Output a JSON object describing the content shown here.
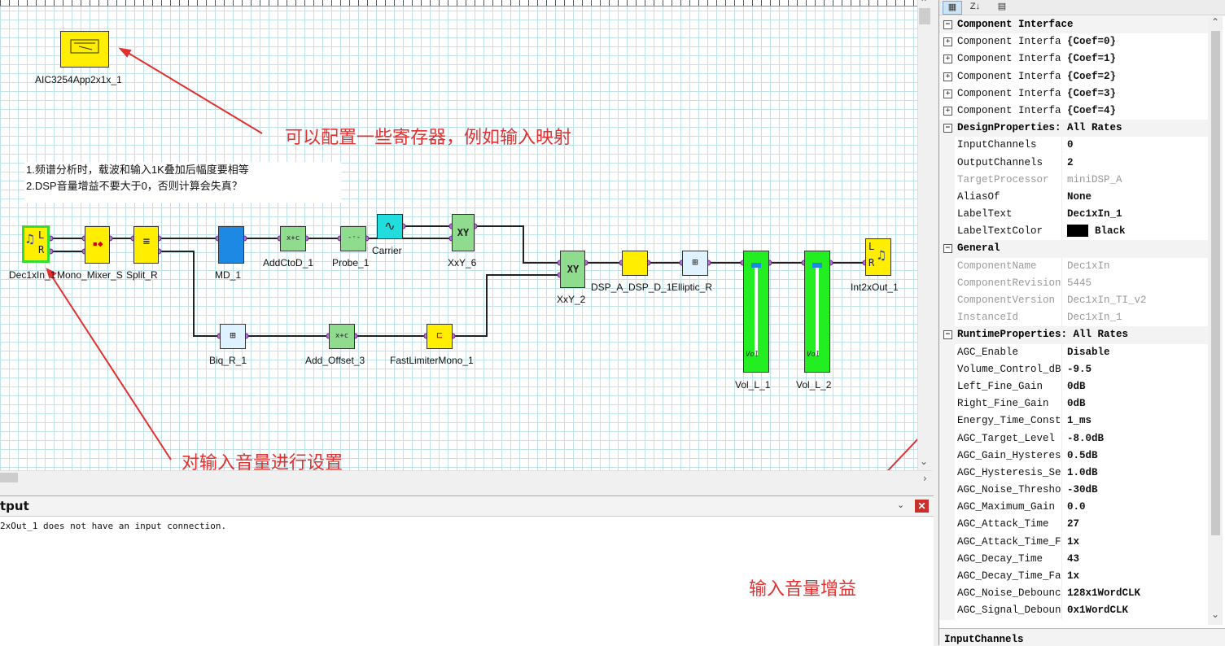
{
  "diagram": {
    "blocks": {
      "aic": "AIC3254App2x1x_1",
      "dec": "Dec1xIn_1",
      "mono": "Mono_Mixer_S",
      "split": "Split_R",
      "md": "MD_1",
      "addctod": "AddCtoD_1",
      "probe": "Probe_1",
      "carrier": "Carrier",
      "xxy6": "XxY_6",
      "xxy2": "XxY_2",
      "dspad": "DSP_A_DSP_D_1",
      "elliptic": "Elliptic_R",
      "voll1": "Vol_L_1",
      "voll2": "Vol_L_2",
      "int2x": "Int2xOut_1",
      "biq": "Biq_R_1",
      "addoffset": "Add_Offset_3",
      "limiter": "FastLimiterMono_1"
    },
    "glyphs": {
      "xy": "XY",
      "add": "x+c",
      "vol": "Vol"
    },
    "note_lines": [
      "1.频谱分析时，载波和输入1K叠加后幅度要相等",
      "2.DSP音量增益不要大于0，否则计算会失真？"
    ]
  },
  "annotations": {
    "registers": "可以配置一些寄存器，例如输入映射",
    "input_volume": "对输入音量进行设置",
    "input_gain": "输入音量增益"
  },
  "output": {
    "title": "tput",
    "message": "2xOut_1 does not have an input connection."
  },
  "properties": {
    "toolbar": {
      "sort_label": "Z↓"
    },
    "rows": [
      {
        "type": "category",
        "expanded": true,
        "name": "Component Interface",
        "value": ""
      },
      {
        "type": "category-sub",
        "expanded": false,
        "name": "Component Interfa",
        "value": "{Coef=0}"
      },
      {
        "type": "category-sub",
        "expanded": false,
        "name": "Component Interfa",
        "value": "{Coef=1}"
      },
      {
        "type": "category-sub",
        "expanded": false,
        "name": "Component Interfa",
        "value": "{Coef=2}"
      },
      {
        "type": "category-sub",
        "expanded": false,
        "name": "Component Interfa",
        "value": "{Coef=3}"
      },
      {
        "type": "category-sub",
        "expanded": false,
        "name": "Component Interfa",
        "value": "{Coef=4}"
      },
      {
        "type": "category",
        "expanded": true,
        "name": "DesignProperties: All Rates",
        "value": ""
      },
      {
        "type": "prop",
        "name": "InputChannels",
        "value": "0"
      },
      {
        "type": "prop",
        "name": "OutputChannels",
        "value": "2"
      },
      {
        "type": "prop",
        "dim": true,
        "name": "TargetProcessor",
        "value": "miniDSP_A"
      },
      {
        "type": "prop",
        "name": "AliasOf",
        "value": "None"
      },
      {
        "type": "prop",
        "name": "LabelText",
        "value": "Dec1xIn_1"
      },
      {
        "type": "prop",
        "name": "LabelTextColor",
        "value": "Black",
        "swatch": "#000000"
      },
      {
        "type": "category",
        "expanded": true,
        "name": "General",
        "value": ""
      },
      {
        "type": "prop",
        "dim": true,
        "name": "ComponentName",
        "value": "Dec1xIn"
      },
      {
        "type": "prop",
        "dim": true,
        "name": "ComponentRevision",
        "value": "5445"
      },
      {
        "type": "prop",
        "dim": true,
        "name": "ComponentVersion",
        "value": "Dec1xIn_TI_v2"
      },
      {
        "type": "prop",
        "dim": true,
        "name": "InstanceId",
        "value": "Dec1xIn_1"
      },
      {
        "type": "category",
        "expanded": true,
        "name": "RuntimeProperties: All Rates",
        "value": ""
      },
      {
        "type": "prop",
        "name": "AGC_Enable",
        "value": "Disable"
      },
      {
        "type": "prop",
        "name": "Volume_Control_dB",
        "value": "-9.5"
      },
      {
        "type": "prop",
        "name": "Left_Fine_Gain",
        "value": "0dB"
      },
      {
        "type": "prop",
        "name": "Right_Fine_Gain",
        "value": "0dB"
      },
      {
        "type": "prop",
        "name": "Energy_Time_Const",
        "value": "1_ms"
      },
      {
        "type": "prop",
        "name": "AGC_Target_Level",
        "value": "-8.0dB"
      },
      {
        "type": "prop",
        "name": "AGC_Gain_Hysteres",
        "value": "0.5dB"
      },
      {
        "type": "prop",
        "name": "AGC_Hysteresis_Se",
        "value": "1.0dB"
      },
      {
        "type": "prop",
        "name": "AGC_Noise_Thresho",
        "value": "-30dB"
      },
      {
        "type": "prop",
        "name": "AGC_Maximum_Gain",
        "value": "0.0"
      },
      {
        "type": "prop",
        "name": "AGC_Attack_Time",
        "value": "27"
      },
      {
        "type": "prop",
        "name": "AGC_Attack_Time_F",
        "value": "1x"
      },
      {
        "type": "prop",
        "name": "AGC_Decay_Time",
        "value": "43"
      },
      {
        "type": "prop",
        "name": "AGC_Decay_Time_Fa",
        "value": "1x"
      },
      {
        "type": "prop",
        "name": "AGC_Noise_Debounc",
        "value": "128x1WordCLK"
      },
      {
        "type": "prop",
        "name": "AGC_Signal_Deboun",
        "value": "0x1WordCLK"
      }
    ],
    "description_title": "InputChannels"
  },
  "colors": {
    "annotation": "#e03030",
    "block_yellow": "#ffee00",
    "block_green": "#8fdc8f",
    "block_blue": "#1e88e5",
    "vol_green": "#22ee22"
  }
}
